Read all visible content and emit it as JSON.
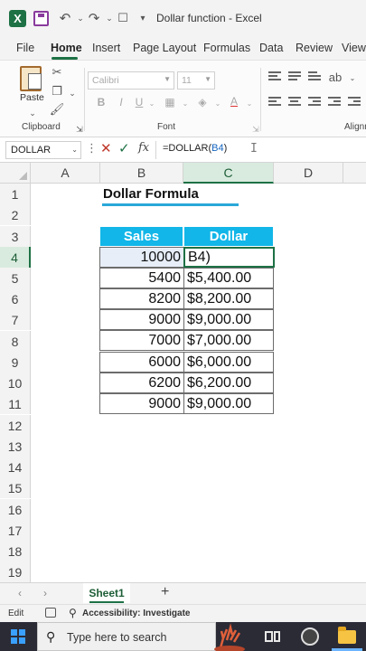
{
  "titlebar": {
    "title": "Dollar function  -  Excel",
    "icons": [
      "excel-logo",
      "save-icon",
      "undo-icon",
      "redo-icon",
      "touch-mode-icon",
      "customize-icon"
    ]
  },
  "menu": {
    "tabs": [
      "File",
      "Home",
      "Insert",
      "Page Layout",
      "Formulas",
      "Data",
      "Review",
      "View"
    ],
    "active": "Home"
  },
  "ribbon": {
    "clipboard": {
      "paste_label": "Paste",
      "group_label": "Clipboard"
    },
    "font": {
      "font_name": "Calibri",
      "font_size": "11",
      "group_label": "Font",
      "bold": "B",
      "italic": "I",
      "underline": "U"
    },
    "alignment": {
      "group_label": "Alignm"
    }
  },
  "formula_bar": {
    "name_box": "DOLLAR",
    "formula_prefix": "=DOLLAR(",
    "formula_ref": "B4",
    "formula_suffix": ")",
    "fx": "fx"
  },
  "grid": {
    "columns": [
      "A",
      "B",
      "C",
      "D"
    ],
    "selected_column": "C",
    "rows": [
      "1",
      "2",
      "3",
      "4",
      "5",
      "6",
      "7",
      "8",
      "9",
      "10",
      "11",
      "12",
      "13",
      "14",
      "15",
      "16",
      "17",
      "18",
      "19"
    ],
    "selected_row": "4",
    "title": "Dollar Formula",
    "table": {
      "headers": [
        "Sales",
        "Dollar"
      ],
      "rows": [
        {
          "sales": "10000",
          "dollar": "B4)"
        },
        {
          "sales": "5400",
          "dollar": "$5,400.00"
        },
        {
          "sales": "8200",
          "dollar": "$8,200.00"
        },
        {
          "sales": "9000",
          "dollar": "$9,000.00"
        },
        {
          "sales": "7000",
          "dollar": "$7,000.00"
        },
        {
          "sales": "6000",
          "dollar": "$6,000.00"
        },
        {
          "sales": "6200",
          "dollar": "$6,200.00"
        },
        {
          "sales": "9000",
          "dollar": "$9,000.00"
        }
      ]
    }
  },
  "sheets": {
    "tabs": [
      "Sheet1"
    ],
    "add": "+"
  },
  "status": {
    "mode": "Edit",
    "accessibility": "Accessibility: Investigate"
  },
  "taskbar": {
    "search_placeholder": "Type here to search"
  },
  "colors": {
    "excel_green": "#1e7145",
    "header_blue": "#12b6e8",
    "title_underline": "#29a8d8"
  }
}
